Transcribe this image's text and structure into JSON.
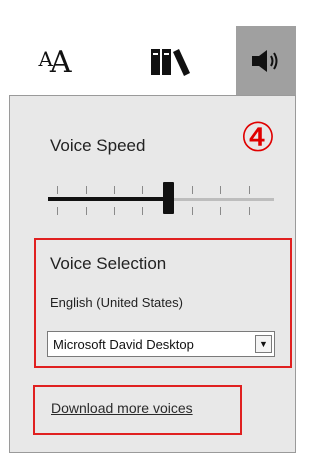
{
  "toolbar": {
    "text_options_glyph_small": "A",
    "text_options_glyph_large": "A",
    "books_icon": "books-icon",
    "voice_icon": "speaker-icon"
  },
  "panel": {
    "voice_speed_label": "Voice Speed",
    "annotation_marker": "④",
    "speed_slider": {
      "value_fraction": 0.55,
      "ticks": 8
    },
    "voice_selection": {
      "title": "Voice Selection",
      "language": "English (United States)",
      "selected_voice": "Microsoft David Desktop"
    },
    "download_link": "Download more voices"
  },
  "colors": {
    "active_tab_bg": "#a0a0a0",
    "panel_bg": "#e8e8e8",
    "highlight_border": "#e02020",
    "annotation": "#e00000"
  }
}
